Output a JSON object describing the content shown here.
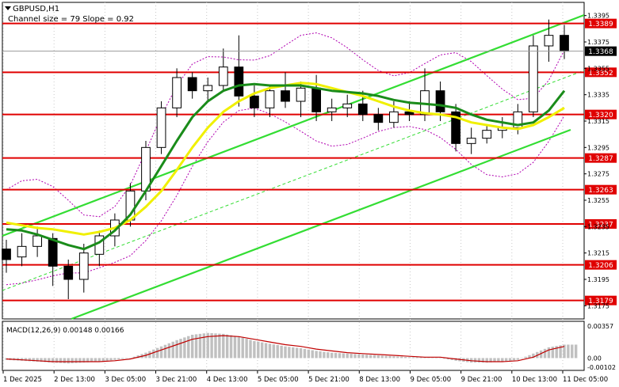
{
  "header": {
    "symbol_label": "GBPUSD,H1",
    "channel_label": "Channel size = 79 Slope = 0.92",
    "arrow_icon": "triangle-down-icon"
  },
  "colors": {
    "background": "#ffffff",
    "candle": "#000000",
    "level_line": "#e00000",
    "level_badge": "#e00000",
    "channel": "#33dd33",
    "ma_fast": "#f0f000",
    "ma_slow": "#1a8c1a",
    "envelope": "#b000b0",
    "macd_hist": "#c0c0c0",
    "macd_signal": "#c00000",
    "price_badge": "#000000"
  },
  "chart_data": [
    {
      "type": "candlestick",
      "title": "GBPUSD,H1",
      "subtitle": "Channel size = 79 Slope = 0.92",
      "current_price": "1.3368",
      "ylim": [
        1.3165,
        1.3405
      ],
      "y_ticks": [
        "1.3395",
        "1.3375",
        "1.3355",
        "1.3335",
        "1.3315",
        "1.3295",
        "1.3275",
        "1.3255",
        "1.3235",
        "1.3215",
        "1.3195",
        "1.3175"
      ],
      "x_labels": [
        "1 Dec 2025",
        "2 Dec 13:00",
        "3 Dec 05:00",
        "3 Dec 21:00",
        "4 Dec 13:00",
        "5 Dec 05:00",
        "5 Dec 21:00",
        "8 Dec 13:00",
        "9 Dec 05:00",
        "9 Dec 21:00",
        "10 Dec 13:00",
        "11 Dec 05:00"
      ],
      "levels": [
        "1.3389",
        "1.3352",
        "1.3320",
        "1.3287",
        "1.3263",
        "1.3237",
        "1.3206",
        "1.3179"
      ],
      "series": [
        {
          "name": "",
          "values": [
            [
              1.3218,
              1.3225,
              1.32,
              1.321
            ],
            [
              1.3212,
              1.323,
              1.3205,
              1.322
            ],
            [
              1.322,
              1.3235,
              1.3212,
              1.3228
            ],
            [
              1.3226,
              1.323,
              1.319,
              1.3205
            ],
            [
              1.3205,
              1.321,
              1.318,
              1.3195
            ],
            [
              1.3195,
              1.3222,
              1.3185,
              1.3215
            ],
            [
              1.3214,
              1.3232,
              1.3205,
              1.3228
            ],
            [
              1.3228,
              1.3245,
              1.322,
              1.324
            ],
            [
              1.324,
              1.3268,
              1.3235,
              1.3262
            ],
            [
              1.3262,
              1.33,
              1.3255,
              1.3295
            ],
            [
              1.3295,
              1.333,
              1.329,
              1.3325
            ],
            [
              1.3325,
              1.3355,
              1.3318,
              1.3348
            ],
            [
              1.3348,
              1.3352,
              1.3332,
              1.3338
            ],
            [
              1.3338,
              1.3348,
              1.333,
              1.3342
            ],
            [
              1.3342,
              1.337,
              1.3338,
              1.3356
            ],
            [
              1.3356,
              1.338,
              1.3326,
              1.3334
            ],
            [
              1.3334,
              1.3342,
              1.3318,
              1.3325
            ],
            [
              1.3325,
              1.3342,
              1.3318,
              1.3338
            ],
            [
              1.3338,
              1.3352,
              1.3325,
              1.333
            ],
            [
              1.333,
              1.3345,
              1.3318,
              1.334
            ],
            [
              1.334,
              1.335,
              1.3315,
              1.3322
            ],
            [
              1.3322,
              1.3332,
              1.3315,
              1.3325
            ],
            [
              1.3325,
              1.3335,
              1.3318,
              1.3328
            ],
            [
              1.3328,
              1.3338,
              1.3315,
              1.332
            ],
            [
              1.332,
              1.3325,
              1.3308,
              1.3314
            ],
            [
              1.3314,
              1.333,
              1.331,
              1.3322
            ],
            [
              1.3322,
              1.333,
              1.3315,
              1.332
            ],
            [
              1.332,
              1.3355,
              1.3315,
              1.3338
            ],
            [
              1.3338,
              1.3345,
              1.3315,
              1.3322
            ],
            [
              1.3322,
              1.3328,
              1.3292,
              1.3298
            ],
            [
              1.3298,
              1.331,
              1.329,
              1.3302
            ],
            [
              1.3302,
              1.3312,
              1.3298,
              1.3308
            ],
            [
              1.3308,
              1.3318,
              1.3302,
              1.331
            ],
            [
              1.331,
              1.3328,
              1.3305,
              1.3322
            ],
            [
              1.3322,
              1.338,
              1.3318,
              1.3372
            ],
            [
              1.3372,
              1.3392,
              1.336,
              1.338
            ],
            [
              1.338,
              1.3388,
              1.3362,
              1.3368
            ]
          ]
        }
      ],
      "overlays": [
        {
          "name": "",
          "kind": "moving_average",
          "role": "fast",
          "values": [
            1.3238,
            1.3236,
            1.3234,
            1.3233,
            1.3231,
            1.3229,
            1.3231,
            1.3234,
            1.324,
            1.325,
            1.3262,
            1.3278,
            1.3295,
            1.331,
            1.3322,
            1.333,
            1.3336,
            1.334,
            1.3342,
            1.3344,
            1.3343,
            1.334,
            1.3337,
            1.3334,
            1.333,
            1.3326,
            1.3323,
            1.3321,
            1.332,
            1.3318,
            1.3314,
            1.3312,
            1.331,
            1.3309,
            1.3312,
            1.3318,
            1.3325
          ]
        },
        {
          "name": "",
          "kind": "moving_average",
          "role": "slow",
          "values": [
            1.3233,
            1.3232,
            1.3229,
            1.3225,
            1.3221,
            1.3218,
            1.3223,
            1.3232,
            1.3244,
            1.3262,
            1.3281,
            1.33,
            1.3318,
            1.333,
            1.3338,
            1.3342,
            1.3343,
            1.3342,
            1.3342,
            1.3342,
            1.334,
            1.3338,
            1.3337,
            1.3336,
            1.3334,
            1.3331,
            1.3329,
            1.3328,
            1.3327,
            1.3325,
            1.332,
            1.3316,
            1.3314,
            1.3312,
            1.3314,
            1.3323,
            1.3338
          ]
        }
      ]
    },
    {
      "type": "bar",
      "title": "MACD(12,26,9) 0.00148 0.00166",
      "y_ticks": [
        "0.00357",
        "0.00",
        "-0.00102"
      ],
      "ylim": [
        -0.00102,
        0.00357
      ],
      "series": [
        {
          "name": "",
          "kind": "histogram",
          "values": [
            -0.0002,
            -0.0003,
            -0.0004,
            -0.0005,
            -0.0006,
            -0.0005,
            -0.0004,
            -0.0002,
            0.0,
            0.0006,
            0.0013,
            0.002,
            0.0026,
            0.0028,
            0.0027,
            0.0024,
            0.0019,
            0.0016,
            0.0013,
            0.0011,
            0.0008,
            0.0006,
            0.0005,
            0.0004,
            0.0003,
            0.0002,
            0.0001,
            0.0001,
            0.0,
            -0.0003,
            -0.0005,
            -0.0005,
            -0.0004,
            -0.0002,
            0.0005,
            0.0012,
            0.0015
          ]
        },
        {
          "name": "",
          "kind": "signal",
          "values": [
            -0.0001,
            -0.0002,
            -0.0003,
            -0.0004,
            -0.0004,
            -0.0004,
            -0.0004,
            -0.0003,
            -0.0001,
            0.0003,
            0.0009,
            0.0015,
            0.0021,
            0.0024,
            0.0025,
            0.0024,
            0.0021,
            0.0018,
            0.0015,
            0.0013,
            0.001,
            0.0008,
            0.0006,
            0.0005,
            0.0004,
            0.0003,
            0.0002,
            0.0001,
            0.0001,
            -0.0001,
            -0.0003,
            -0.0004,
            -0.0004,
            -0.0003,
            0.0001,
            0.0009,
            0.0013
          ]
        }
      ]
    }
  ]
}
